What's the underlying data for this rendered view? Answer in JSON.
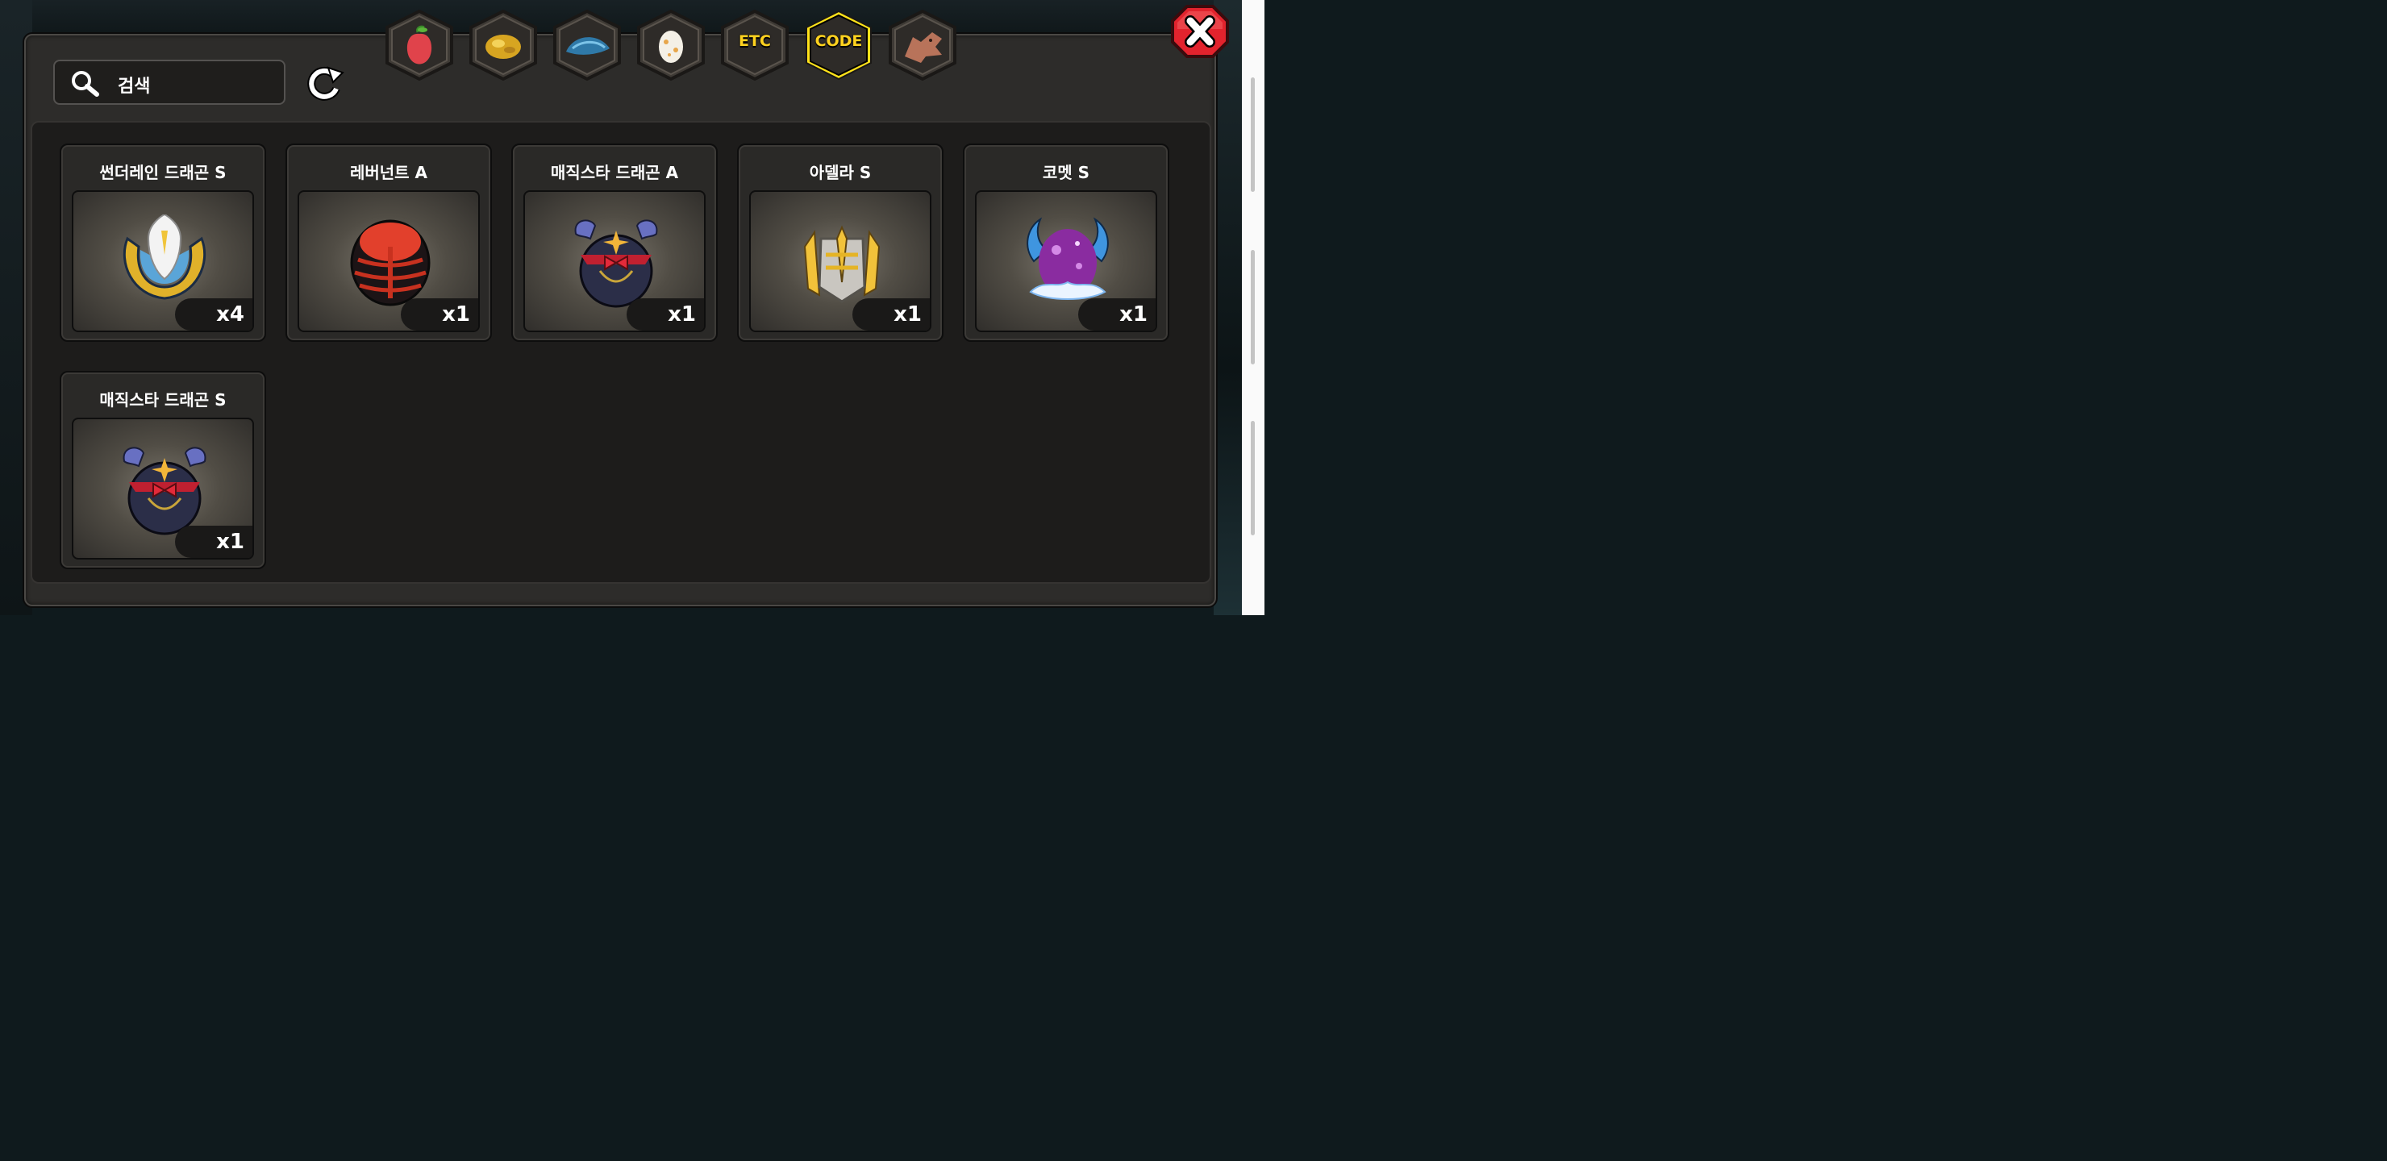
{
  "search": {
    "placeholder": "검색"
  },
  "tabs": [
    {
      "id": "fruit",
      "icon": "red-fruit-icon"
    },
    {
      "id": "gold",
      "icon": "gold-nugget-icon"
    },
    {
      "id": "scale",
      "icon": "blue-scale-icon"
    },
    {
      "id": "egg",
      "icon": "spotted-egg-icon"
    },
    {
      "id": "etc",
      "label": "ETC"
    },
    {
      "id": "code",
      "label": "CODE",
      "selected": true
    },
    {
      "id": "dragon",
      "icon": "dragon-head-icon"
    }
  ],
  "items": [
    {
      "name": "썬더레인 드래곤 S",
      "quantity": "x4",
      "icon": "thunderrain-emblem-icon"
    },
    {
      "name": "레버넌트 A",
      "quantity": "x1",
      "icon": "revenant-egg-icon"
    },
    {
      "name": "매직스타 드래곤 A",
      "quantity": "x1",
      "icon": "magicstar-dragon-icon"
    },
    {
      "name": "아델라 S",
      "quantity": "x1",
      "icon": "adela-helmet-icon"
    },
    {
      "name": "코멧 S",
      "quantity": "x1",
      "icon": "comet-egg-icon"
    },
    {
      "name": "매직스타 드래곤 S",
      "quantity": "x1",
      "icon": "magicstar-dragon-icon"
    }
  ],
  "colors": {
    "panel": "#2d2c2a",
    "content": "#1d1c1b",
    "card": "#2a2927",
    "selected_tab": "#ffd21f",
    "close_button": "#e2232d"
  }
}
